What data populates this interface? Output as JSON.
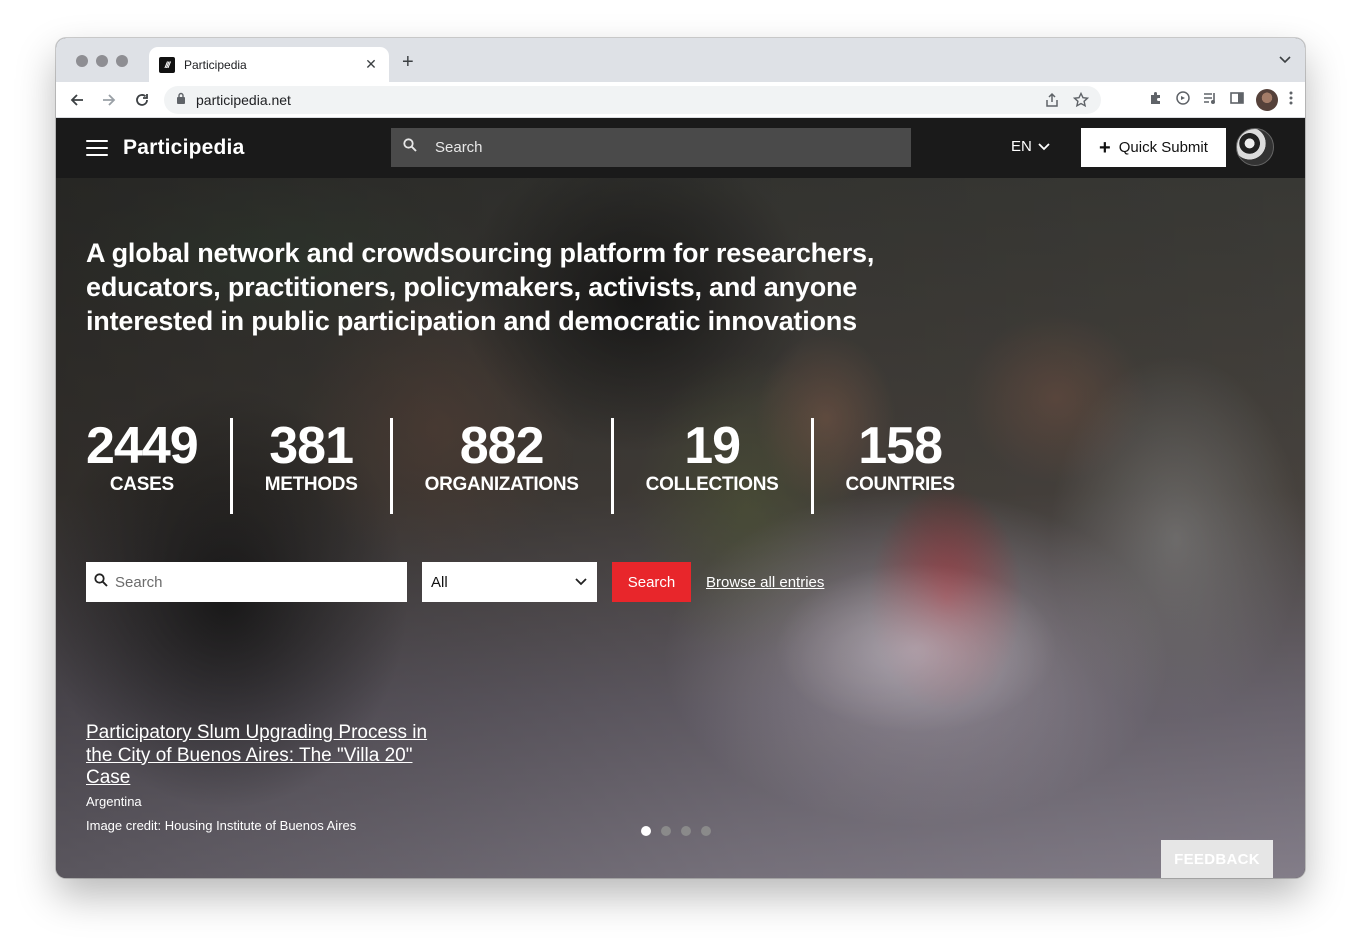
{
  "browser": {
    "tab_title": "Participedia",
    "tab_favicon_text": "///",
    "url": "participedia.net"
  },
  "header": {
    "brand": "Participedia",
    "search_placeholder": "Search",
    "language": "EN",
    "quick_submit_label": "Quick Submit"
  },
  "hero": {
    "tagline": "A global network and crowdsourcing platform for researchers, educators, practitioners, policymakers, activists, and anyone interested in public participation and democratic innovations",
    "stats": [
      {
        "value": "2449",
        "label": "CASES"
      },
      {
        "value": "381",
        "label": "METHODS"
      },
      {
        "value": "882",
        "label": "ORGANIZATIONS"
      },
      {
        "value": "19",
        "label": "COLLECTIONS"
      },
      {
        "value": "158",
        "label": "COUNTRIES"
      }
    ],
    "search_placeholder": "Search",
    "filter_selected": "All",
    "search_button": "Search",
    "browse_link": "Browse all entries",
    "featured_case": {
      "title": "Participatory Slum Upgrading Process in the City of Buenos Aires: The \"Villa 20\" Case",
      "country": "Argentina",
      "credit": "Image credit: Housing Institute of Buenos Aires"
    },
    "carousel": {
      "total": 4,
      "active": 1
    }
  },
  "feedback_label": "FEEDBACK",
  "colors": {
    "header_bg": "#1a1a1a",
    "accent_red": "#e8262b",
    "top_search_bg": "#4a4a4a"
  }
}
